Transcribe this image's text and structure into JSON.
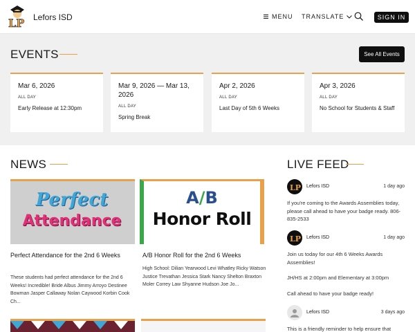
{
  "header": {
    "site_name": "Lefors ISD",
    "menu_label": "MENU",
    "translate_label": "TRANSLATE",
    "signin_label": "SIGN IN",
    "logo_text": "LP"
  },
  "events": {
    "title": "EVENTS",
    "see_all_label": "See All Events",
    "items": [
      {
        "date": "Mar 6, 2026",
        "allday": "ALL DAY",
        "title": "Early Release at 12:30pm"
      },
      {
        "date": "Mar 9, 2026 — Mar 13, 2026",
        "allday": "ALL DAY",
        "title": "Spring Break"
      },
      {
        "date": "Apr 2, 2026",
        "allday": "ALL DAY",
        "title": "Last Day of 5th 6 Weeks"
      },
      {
        "date": "Apr 3, 2026",
        "allday": "ALL DAY",
        "title": "No School for Students & Staff"
      }
    ]
  },
  "news": {
    "title": "NEWS",
    "items": [
      {
        "image_text_1": "Perfect",
        "image_text_2": "Attendance",
        "headline": "Perfect Attendance for the 2nd 6 Weeks",
        "body": "These students had perfect attendance for the 2nd 6 Weeks! Incredible! Bride Albus Jimmy Arroyo Destinee Bowman Jasper Callaway Nolan Caywood Korbin Cook Ch..."
      },
      {
        "image_text_a": "A",
        "image_text_slash": "/",
        "image_text_b": "B",
        "image_text_2": "Honor Roll",
        "headline": "A/B Honor Roll for the 2nd 6 Weeks",
        "body": "High School: Dilian Yearwood Levi Whatley Ricky Watson Justice Trevathan Jessica Stark Nancy Shelton Braxton Moler Correy Law Shyanne Hudson Joe Jo..."
      }
    ]
  },
  "feed": {
    "title": "LIVE FEED",
    "items": [
      {
        "name": "Lefors ISD",
        "time": "1 day ago",
        "paragraphs": [
          "If you're coming to the Awards Assemblies today, please call ahead to have your badge ready. 806-835-2533"
        ]
      },
      {
        "name": "Lefors ISD",
        "time": "1 day ago",
        "paragraphs": [
          "Join us today for our 4th 6 Weeks Awards Assemblies!",
          "JH/HS at 2:00pm and Elementary at 3:00pm",
          "Call ahead to have your badge ready!"
        ]
      },
      {
        "name": "Lefors ISD",
        "time": "3 days ago",
        "paragraphs": [
          "This is a friendly reminder to help ensure that"
        ]
      }
    ]
  },
  "colors": {
    "accent": "#e8a04a",
    "button": "#0f0f0f",
    "section_bg": "#f0f0f0"
  }
}
